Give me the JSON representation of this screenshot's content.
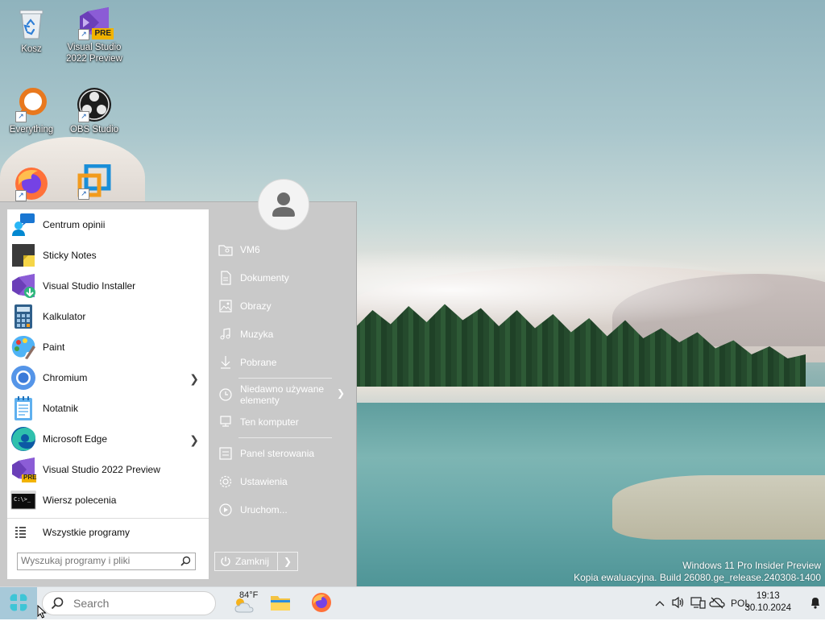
{
  "desktop": {
    "icons": [
      {
        "label": "Kosz",
        "icon": "recycle-bin-icon"
      },
      {
        "label": "Visual Studio\n2022 Preview",
        "icon": "visual-studio-preview-icon",
        "badge": "PRE"
      },
      {
        "label": "Everything",
        "icon": "everything-search-icon"
      },
      {
        "label": "OBS Studio",
        "icon": "obs-studio-icon"
      },
      {
        "label": "",
        "icon": "firefox-icon"
      },
      {
        "label": "",
        "icon": "vmware-icon"
      }
    ]
  },
  "start_menu": {
    "programs": [
      {
        "label": "Centrum opinii",
        "icon": "feedback-hub-icon",
        "has_submenu": false
      },
      {
        "label": "Sticky Notes",
        "icon": "sticky-notes-icon",
        "has_submenu": false
      },
      {
        "label": "Visual Studio Installer",
        "icon": "visual-studio-installer-icon",
        "has_submenu": false
      },
      {
        "label": "Kalkulator",
        "icon": "calculator-icon",
        "has_submenu": false
      },
      {
        "label": "Paint",
        "icon": "paint-icon",
        "has_submenu": false
      },
      {
        "label": "Chromium",
        "icon": "chromium-icon",
        "has_submenu": true
      },
      {
        "label": "Notatnik",
        "icon": "notepad-icon",
        "has_submenu": false
      },
      {
        "label": "Microsoft Edge",
        "icon": "edge-icon",
        "has_submenu": true
      },
      {
        "label": "Visual Studio 2022 Preview",
        "icon": "visual-studio-preview-icon",
        "has_submenu": false
      },
      {
        "label": "Wiersz polecenia",
        "icon": "command-prompt-icon",
        "has_submenu": false
      }
    ],
    "all_programs_label": "Wszystkie programy",
    "search_placeholder": "Wyszukaj programy i pliki",
    "cmd_glyph": "C:\\>_",
    "pre_badge": "PRE",
    "right_items": [
      {
        "label": "VM6",
        "icon": "user-folder-icon"
      },
      {
        "label": "Dokumenty",
        "icon": "documents-icon"
      },
      {
        "label": "Obrazy",
        "icon": "pictures-icon"
      },
      {
        "label": "Muzyka",
        "icon": "music-icon"
      },
      {
        "label": "Pobrane",
        "icon": "downloads-icon"
      },
      {
        "label": "Niedawno używane\nelementy",
        "icon": "recent-items-icon",
        "has_submenu": true
      },
      {
        "label": "Ten komputer",
        "icon": "computer-icon"
      },
      {
        "label": "Panel sterowania",
        "icon": "control-panel-icon"
      },
      {
        "label": "Ustawienia",
        "icon": "settings-icon"
      },
      {
        "label": "Uruchom...",
        "icon": "run-icon"
      }
    ],
    "shutdown_label": "Zamknij"
  },
  "watermark": {
    "line1": "Windows 11 Pro Insider Preview",
    "line2": "Kopia ewaluacyjna. Build 26080.ge_release.240308-1400"
  },
  "taskbar": {
    "search_placeholder": "Search",
    "weather_temp": "84°F",
    "language": "POL",
    "time": "19:13",
    "date": "30.10.2024",
    "accent": "#a7c9d9"
  }
}
